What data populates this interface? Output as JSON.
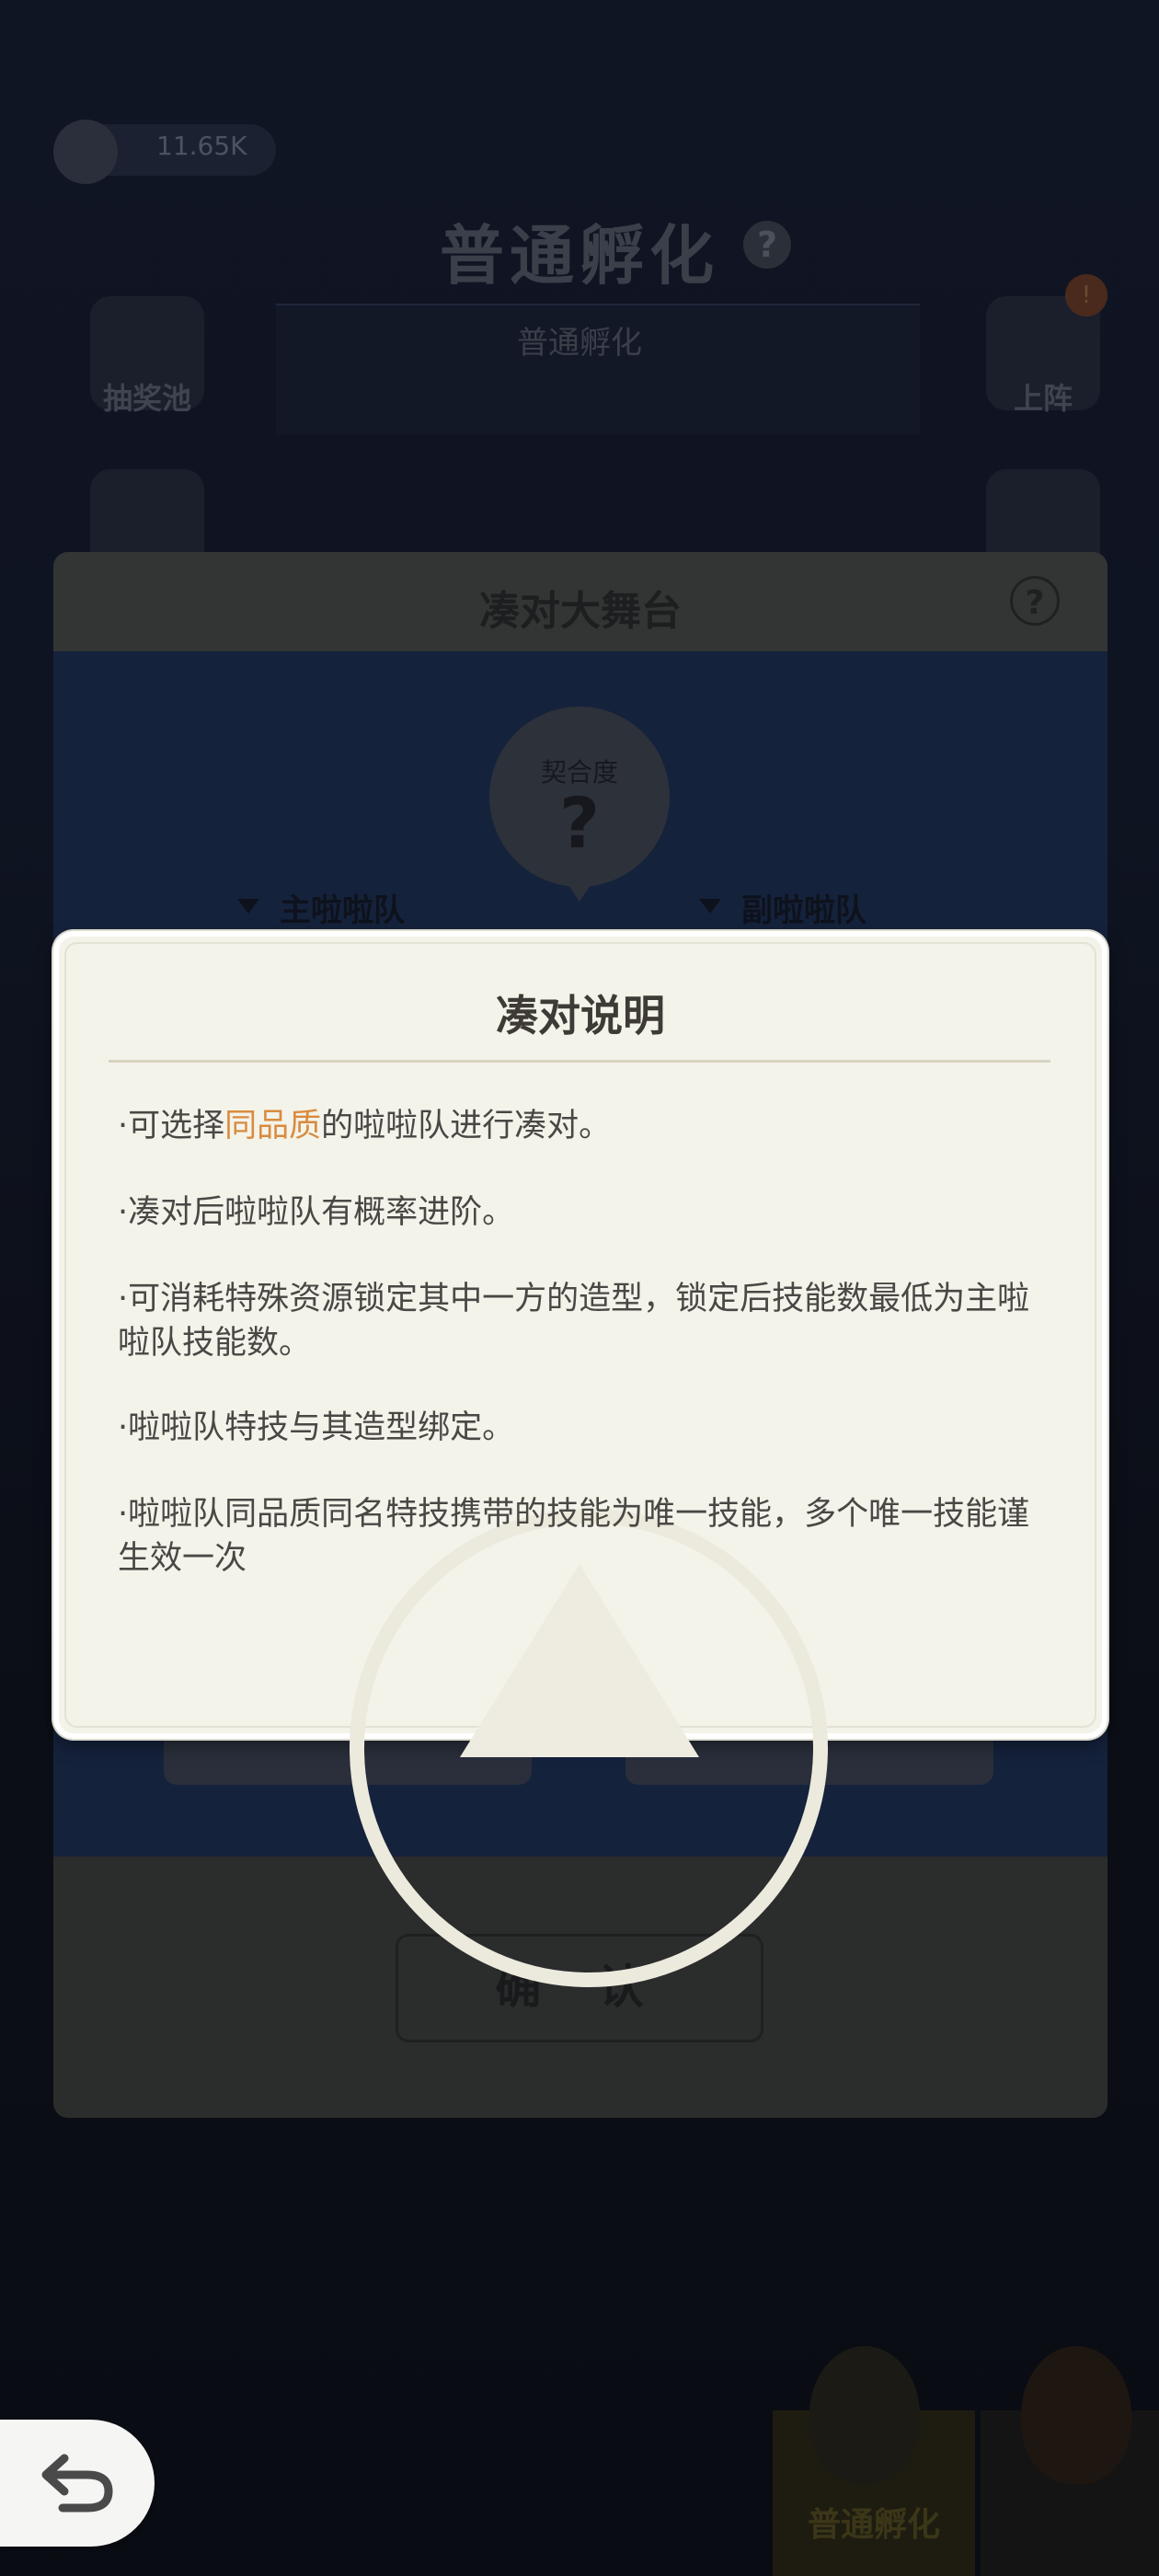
{
  "background": {
    "currency_value": "11.65K",
    "hatch_title": "普通孵化",
    "hatch_tab": "普通孵化",
    "side_left": [
      {
        "label": "抽奖池"
      }
    ],
    "side_right": [
      {
        "label": "上阵"
      }
    ],
    "bottom_hatch_label": "普通孵化"
  },
  "stage_panel": {
    "title": "凑对大舞台",
    "fit_label": "契合度",
    "fit_value": "?",
    "main_team_label": "主啦啦队",
    "sub_team_label": "副啦啦队",
    "confirm_label": "确 认"
  },
  "dialog": {
    "title": "凑对说明",
    "rule1_prefix": "·可选择",
    "rule1_highlight": "同品质",
    "rule1_suffix": "的啦啦队进行凑对。",
    "rule2": "·凑对后啦啦队有概率进阶。",
    "rule3": "·可消耗特殊资源锁定其中一方的造型，锁定后技能数最低为主啦啦队技能数。",
    "rule4": "·啦啦队特技与其造型绑定。",
    "rule5": "·啦啦队同品质同名特技携带的技能为唯一技能，多个唯一技能谨生效一次"
  },
  "colors": {
    "highlight": "#d98b3e",
    "dialog_bg": "#f3f3ea",
    "text": "#4a4744"
  }
}
